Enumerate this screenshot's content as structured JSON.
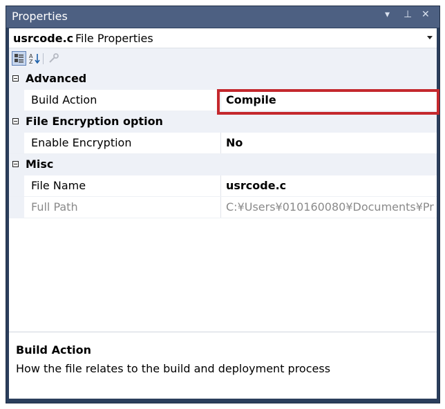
{
  "window": {
    "title": "Properties",
    "controls": {
      "dropdown": "▾",
      "pin": "⊥",
      "close": "✕"
    }
  },
  "header": {
    "object_name": "usrcode.c",
    "object_type": "File Properties"
  },
  "toolbar": {
    "items": [
      {
        "icon": "categorized-icon",
        "active": true
      },
      {
        "icon": "alphabetical-sort-icon",
        "active": false
      },
      {
        "icon": "property-pages-wrench-icon",
        "active": false
      }
    ]
  },
  "grid": {
    "categories": [
      {
        "label": "Advanced",
        "properties": [
          {
            "name": "Build Action",
            "value": "Compile",
            "bold": true,
            "highlighted": true
          }
        ]
      },
      {
        "label": "File Encryption option",
        "properties": [
          {
            "name": "Enable Encryption",
            "value": "No",
            "bold": true
          }
        ]
      },
      {
        "label": "Misc",
        "properties": [
          {
            "name": "File Name",
            "value": "usrcode.c",
            "bold": true
          },
          {
            "name": "Full Path",
            "value": "C:¥Users¥010160080¥Documents¥Pr",
            "bold": false,
            "disabled": true
          }
        ]
      }
    ]
  },
  "description": {
    "title": "Build Action",
    "text": "How the file relates to the build and deployment process"
  },
  "colors": {
    "titlebar": "#4d6082",
    "frame": "#2b3e5c",
    "category_bg": "#eef1f7",
    "highlight": "#c4282d"
  }
}
